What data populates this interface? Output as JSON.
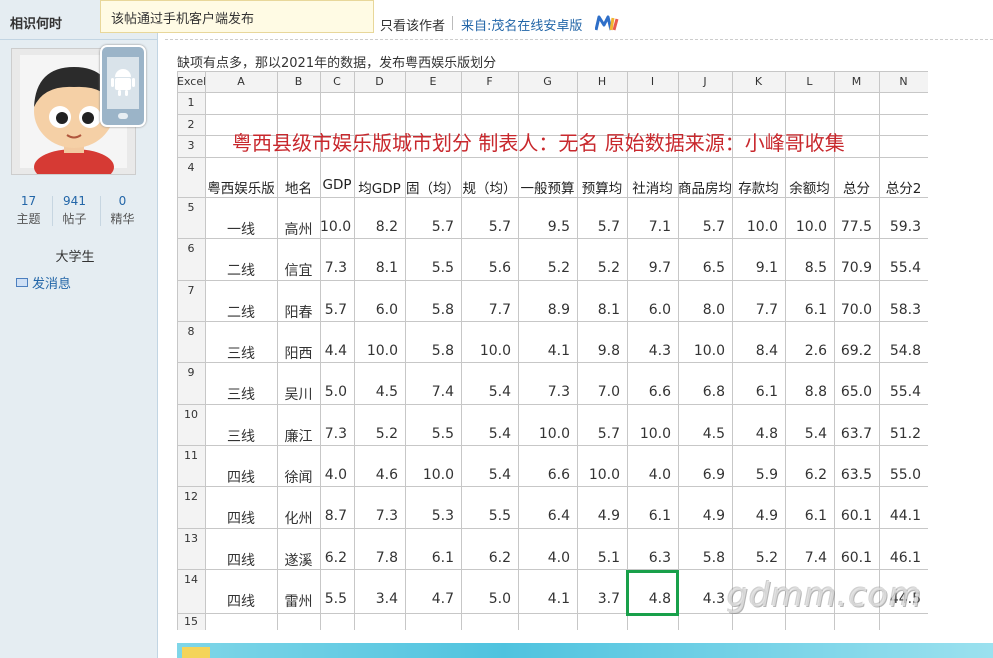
{
  "sidebar": {
    "username": "相识何时",
    "stats": [
      {
        "num": "17",
        "label": "主题"
      },
      {
        "num": "941",
        "label": "帖子"
      },
      {
        "num": "0",
        "label": "精华"
      }
    ],
    "rank": "大学生",
    "pm_label": "发消息"
  },
  "tooltip": "该帖通过手机客户端发布",
  "header": {
    "author_label": "只看该作者",
    "source_label": "来自:茂名在线安卓版"
  },
  "post": {
    "caption": "缺项有点多，那以2021年的数据，发布粤西娱乐版划分"
  },
  "sheet": {
    "corner": "Excel",
    "col_letters": [
      "A",
      "B",
      "C",
      "D",
      "E",
      "F",
      "G",
      "H",
      "I",
      "J",
      "K",
      "L",
      "M",
      "N"
    ],
    "row_numbers": [
      "1",
      "2",
      "3",
      "4",
      "5",
      "6",
      "7",
      "8",
      "9",
      "10",
      "11",
      "12",
      "13",
      "14",
      "15"
    ],
    "title": "粤西县级市娱乐版城市划分   制表人：无名    原始数据来源：小峰哥收集",
    "headers": [
      "粤西娱乐版",
      "地名",
      "GDP",
      "均GDP",
      "固（均）",
      "规（均）",
      "一般预算",
      "预算均",
      "社消均",
      "商品房均",
      "存款均",
      "余额均",
      "总分",
      "总分2"
    ],
    "rows": [
      [
        "一线",
        "高州",
        "10.0",
        "8.2",
        "5.7",
        "5.7",
        "9.5",
        "5.7",
        "7.1",
        "5.7",
        "10.0",
        "10.0",
        "77.5",
        "59.3"
      ],
      [
        "二线",
        "信宜",
        "7.3",
        "8.1",
        "5.5",
        "5.6",
        "5.2",
        "5.2",
        "9.7",
        "6.5",
        "9.1",
        "8.5",
        "70.9",
        "55.4"
      ],
      [
        "二线",
        "阳春",
        "5.7",
        "6.0",
        "5.8",
        "7.7",
        "8.9",
        "8.1",
        "6.0",
        "8.0",
        "7.7",
        "6.1",
        "70.0",
        "58.3"
      ],
      [
        "三线",
        "阳西",
        "4.4",
        "10.0",
        "5.8",
        "10.0",
        "4.1",
        "9.8",
        "4.3",
        "10.0",
        "8.4",
        "2.6",
        "69.2",
        "54.8"
      ],
      [
        "三线",
        "吴川",
        "5.0",
        "4.5",
        "7.4",
        "5.4",
        "7.3",
        "7.0",
        "6.6",
        "6.8",
        "6.1",
        "8.8",
        "65.0",
        "55.4"
      ],
      [
        "三线",
        "廉江",
        "7.3",
        "5.2",
        "5.5",
        "5.4",
        "10.0",
        "5.7",
        "10.0",
        "4.5",
        "4.8",
        "5.4",
        "63.7",
        "51.2"
      ],
      [
        "四线",
        "徐闻",
        "4.0",
        "4.6",
        "10.0",
        "5.4",
        "6.6",
        "10.0",
        "4.0",
        "6.9",
        "5.9",
        "6.2",
        "63.5",
        "55.0"
      ],
      [
        "四线",
        "化州",
        "8.7",
        "7.3",
        "5.3",
        "5.5",
        "6.4",
        "4.9",
        "6.1",
        "4.9",
        "4.9",
        "6.1",
        "60.1",
        "44.1"
      ],
      [
        "四线",
        "遂溪",
        "6.2",
        "7.8",
        "6.1",
        "6.2",
        "4.0",
        "5.1",
        "6.3",
        "5.8",
        "5.2",
        "7.4",
        "60.1",
        "46.1"
      ],
      [
        "四线",
        "雷州",
        "5.5",
        "3.4",
        "4.7",
        "5.0",
        "4.1",
        "3.7",
        "4.8",
        "4.3",
        "",
        "",
        "",
        "44.5"
      ]
    ],
    "selected_cell": {
      "row": 14,
      "col": "I"
    },
    "accent_color": "#18a04a",
    "title_color": "#c8282d"
  },
  "watermark": "gdmm.com",
  "colors": {
    "sidebar_bg": "#e5edf2",
    "link": "#2366a8"
  }
}
